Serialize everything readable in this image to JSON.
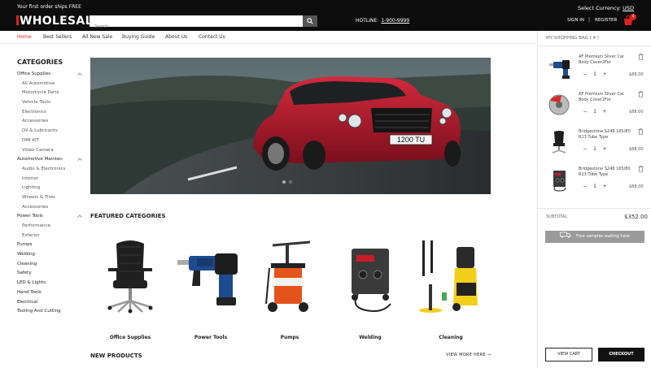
{
  "topbar": {
    "shipping_text": "Your first order ships FREE",
    "logo_text": "WHOLESALE",
    "search_placeholder": "Search",
    "hotline_label": "HOTLINE:",
    "hotline_number": "1-900-9999",
    "currency_label": "Select Currency:",
    "currency_value": "USD",
    "signin_label": "SIGN IN",
    "separator": "|",
    "register_label": "REGISTER",
    "cart_count": "4"
  },
  "nav": {
    "items": [
      "Home",
      "Best Sellers",
      "All New Sale",
      "Buying Guide",
      "About Us",
      "Contact Us"
    ]
  },
  "sidebar": {
    "title": "CATEGORIES",
    "categories": [
      {
        "label": "Office Supplies",
        "sub": false,
        "chevron": "^"
      },
      {
        "label": "All Automotive",
        "sub": true
      },
      {
        "label": "Motorcycle Parts",
        "sub": true
      },
      {
        "label": "Vehicle Tools",
        "sub": true
      },
      {
        "label": "Electronics",
        "sub": true
      },
      {
        "label": "Accessories",
        "sub": true
      },
      {
        "label": "Oil & Lubricants",
        "sub": true
      },
      {
        "label": "DMI KIT",
        "sub": true
      },
      {
        "label": "Video Camera",
        "sub": true
      },
      {
        "label": "Automotive Mainten",
        "sub": false,
        "chevron": "^"
      },
      {
        "label": "Audio & Electronics",
        "sub": true
      },
      {
        "label": "Interior",
        "sub": true
      },
      {
        "label": "Lighting",
        "sub": true
      },
      {
        "label": "Wheels & Tires",
        "sub": true
      },
      {
        "label": "Accessories",
        "sub": true
      },
      {
        "label": "Power Tools",
        "sub": false,
        "chevron": "^"
      },
      {
        "label": "Performance",
        "sub": true
      },
      {
        "label": "Exterior",
        "sub": true
      },
      {
        "label": "Pumps",
        "sub": false
      },
      {
        "label": "Welding",
        "sub": false
      },
      {
        "label": "Cleaning",
        "sub": false
      },
      {
        "label": "Safety",
        "sub": false
      },
      {
        "label": "LED & Lights",
        "sub": false
      },
      {
        "label": "Hand Tools",
        "sub": false
      },
      {
        "label": "Electrical",
        "sub": false
      },
      {
        "label": "Tooling And Cutting",
        "sub": false
      }
    ]
  },
  "banner": {
    "plate_text": "1200 TU"
  },
  "featured": {
    "title": "FEATURED CATEGORIES",
    "items": [
      {
        "label": "Office Supplies",
        "icon": "office-chair-icon"
      },
      {
        "label": "Power Tools",
        "icon": "rotary-hammer-icon"
      },
      {
        "label": "Pumps",
        "icon": "grease-pump-icon"
      },
      {
        "label": "Welding",
        "icon": "welder-icon"
      },
      {
        "label": "Cleaning",
        "icon": "pressure-washer-icon"
      }
    ]
  },
  "new_products": {
    "title": "NEW PRODUCTS",
    "view_more": "VIEW MORE HERE"
  },
  "bag": {
    "title": "MY SHOPPING BAG ( 4 )",
    "items": [
      {
        "name": "AF Premium Silver Car Body Cover2For",
        "qty": "1",
        "price": "$88.00",
        "icon": "rotary-hammer-icon"
      },
      {
        "name": "AF Premium Silver Car Body Cover2For",
        "qty": "1",
        "price": "$88.00",
        "icon": "brake-disc-icon"
      },
      {
        "name": "Bridgestone S248 165/80 R13 Tube Type",
        "qty": "1",
        "price": "$88.00",
        "icon": "office-chair-icon"
      },
      {
        "name": "Bridgestone S248 165/80 R13 Tube Type",
        "qty": "1",
        "price": "$88.00",
        "icon": "welder-icon"
      }
    ],
    "minus": "−",
    "plus": "+",
    "subtotal_label": "SUBTOTAL",
    "subtotal_value": "$352.00",
    "samples_text": "Free samples waiting here",
    "view_cart": "VIEW CART",
    "checkout": "CHECKOUT"
  },
  "colors": {
    "accent": "#e02020",
    "topbar": "#0d0d0d",
    "car": "#b3182a"
  }
}
